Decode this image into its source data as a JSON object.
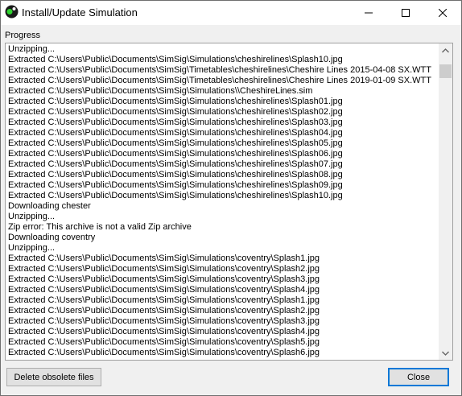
{
  "window": {
    "title": "Install/Update Simulation",
    "icon": "simsig-app-icon"
  },
  "titlebar_buttons": {
    "minimize_icon": "minimize-icon",
    "maximize_icon": "maximize-icon",
    "close_icon": "close-icon"
  },
  "progress": {
    "label": "Progress",
    "lines": [
      "Unzipping...",
      "Extracted C:\\Users\\Public\\Documents\\SimSig\\Simulations\\cheshirelines\\Splash10.jpg",
      "Extracted C:\\Users\\Public\\Documents\\SimSig\\Timetables\\cheshirelines\\Cheshire Lines 2015-04-08 SX.WTT",
      "Extracted C:\\Users\\Public\\Documents\\SimSig\\Timetables\\cheshirelines\\Cheshire Lines 2019-01-09 SX.WTT",
      "Extracted C:\\Users\\Public\\Documents\\SimSig\\Simulations\\\\CheshireLines.sim",
      "Extracted C:\\Users\\Public\\Documents\\SimSig\\Simulations\\cheshirelines\\Splash01.jpg",
      "Extracted C:\\Users\\Public\\Documents\\SimSig\\Simulations\\cheshirelines\\Splash02.jpg",
      "Extracted C:\\Users\\Public\\Documents\\SimSig\\Simulations\\cheshirelines\\Splash03.jpg",
      "Extracted C:\\Users\\Public\\Documents\\SimSig\\Simulations\\cheshirelines\\Splash04.jpg",
      "Extracted C:\\Users\\Public\\Documents\\SimSig\\Simulations\\cheshirelines\\Splash05.jpg",
      "Extracted C:\\Users\\Public\\Documents\\SimSig\\Simulations\\cheshirelines\\Splash06.jpg",
      "Extracted C:\\Users\\Public\\Documents\\SimSig\\Simulations\\cheshirelines\\Splash07.jpg",
      "Extracted C:\\Users\\Public\\Documents\\SimSig\\Simulations\\cheshirelines\\Splash08.jpg",
      "Extracted C:\\Users\\Public\\Documents\\SimSig\\Simulations\\cheshirelines\\Splash09.jpg",
      "Extracted C:\\Users\\Public\\Documents\\SimSig\\Simulations\\cheshirelines\\Splash10.jpg",
      "Downloading chester",
      "Unzipping...",
      "Zip error: This archive is not a valid Zip archive",
      "Downloading coventry",
      "Unzipping...",
      "Extracted C:\\Users\\Public\\Documents\\SimSig\\Simulations\\coventry\\Splash1.jpg",
      "Extracted C:\\Users\\Public\\Documents\\SimSig\\Simulations\\coventry\\Splash2.jpg",
      "Extracted C:\\Users\\Public\\Documents\\SimSig\\Simulations\\coventry\\Splash3.jpg",
      "Extracted C:\\Users\\Public\\Documents\\SimSig\\Simulations\\coventry\\Splash4.jpg",
      "Extracted C:\\Users\\Public\\Documents\\SimSig\\Simulations\\coventry\\Splash1.jpg",
      "Extracted C:\\Users\\Public\\Documents\\SimSig\\Simulations\\coventry\\Splash2.jpg",
      "Extracted C:\\Users\\Public\\Documents\\SimSig\\Simulations\\coventry\\Splash3.jpg",
      "Extracted C:\\Users\\Public\\Documents\\SimSig\\Simulations\\coventry\\Splash4.jpg",
      "Extracted C:\\Users\\Public\\Documents\\SimSig\\Simulations\\coventry\\Splash5.jpg",
      "Extracted C:\\Users\\Public\\Documents\\SimSig\\Simulations\\coventry\\Splash6.jpg"
    ],
    "scroll_up_icon": "scroll-up-arrow-icon",
    "scroll_down_icon": "scroll-down-arrow-icon"
  },
  "buttons": {
    "delete_obsolete": "Delete obsolete files",
    "close": "Close"
  }
}
